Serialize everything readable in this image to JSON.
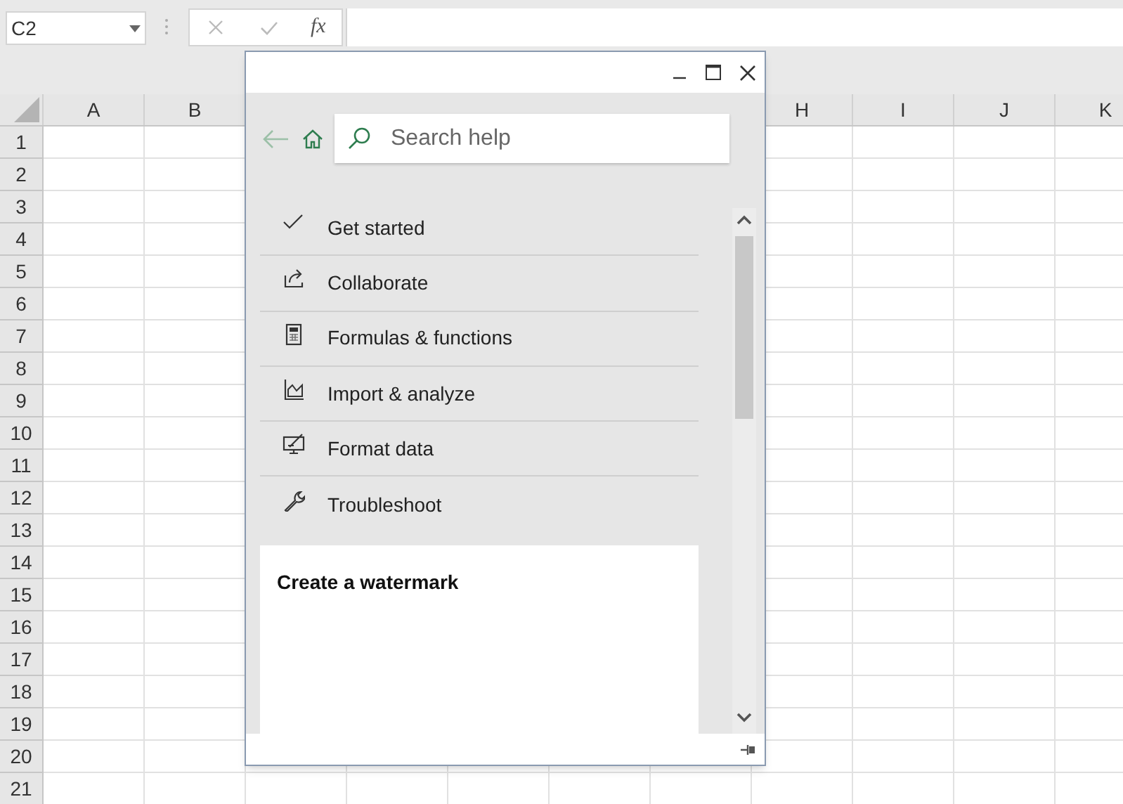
{
  "name_box": {
    "value": "C2"
  },
  "formula_bar": {
    "function_label": "fx"
  },
  "column_headers": [
    "A",
    "B",
    "H",
    "I",
    "J",
    "K"
  ],
  "row_headers": [
    "1",
    "2",
    "3",
    "4",
    "5",
    "6",
    "7",
    "8",
    "9",
    "10",
    "11",
    "12",
    "13",
    "14",
    "15",
    "16",
    "17",
    "18",
    "19",
    "20",
    "21"
  ],
  "help_pane": {
    "search": {
      "placeholder": "Search help"
    },
    "topics": [
      {
        "label": "Get started",
        "kind": "check"
      },
      {
        "label": "Collaborate",
        "kind": "share"
      },
      {
        "label": "Formulas & functions",
        "kind": "calculator"
      },
      {
        "label": "Import & analyze",
        "kind": "chart"
      },
      {
        "label": "Format data",
        "kind": "format"
      },
      {
        "label": "Troubleshoot",
        "kind": "wrench"
      }
    ],
    "article": {
      "title": "Create a watermark"
    }
  }
}
